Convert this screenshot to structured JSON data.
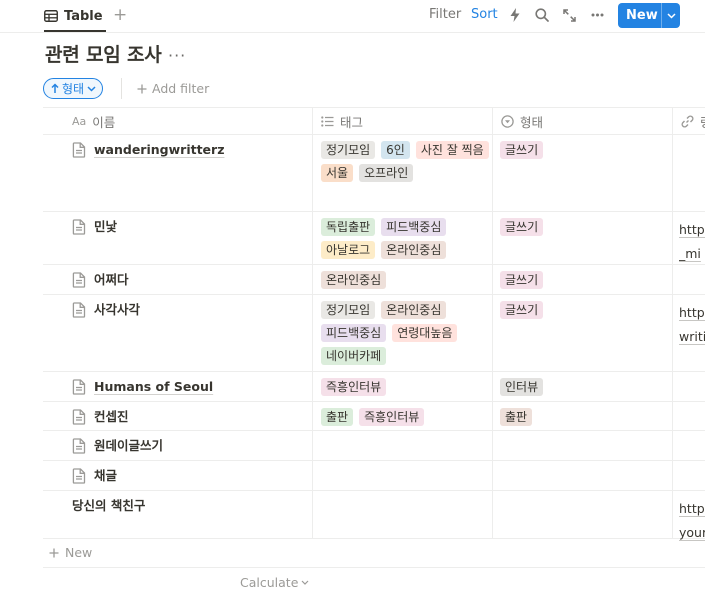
{
  "toolbar": {
    "view_tab": "Table",
    "view_icon": "table-icon",
    "add_view_symbol": "+",
    "filter_label": "Filter",
    "sort_label": "Sort",
    "new_label": "New",
    "accent_color": "#2383e2"
  },
  "page": {
    "title": "관련 모임 조사",
    "more_symbol": "···"
  },
  "filters": {
    "sort_chip_label": "형태",
    "add_filter_label": "Add filter"
  },
  "table": {
    "columns": [
      {
        "label": "이름",
        "icon_text": "Aa"
      },
      {
        "label": "태그",
        "icon": "list-icon"
      },
      {
        "label": "형태",
        "icon": "select-icon"
      },
      {
        "label": "링",
        "icon": "link-icon"
      }
    ],
    "rows": [
      {
        "name": "wanderingwritterz",
        "has_doc_icon": true,
        "underline": true,
        "tags": [
          {
            "label": "정기모임",
            "color": "#e9e8e5"
          },
          {
            "label": "6인",
            "color": "#d3e5ef"
          },
          {
            "label": "사진 잘 찍음",
            "color": "#ffe2dd"
          },
          {
            "label": "서울",
            "color": "#fadec9"
          },
          {
            "label": "오프라인",
            "color": "#e3e2e0"
          }
        ],
        "type": [
          {
            "label": "글쓰기",
            "color": "#f5e0e9"
          }
        ],
        "link": ""
      },
      {
        "name": "민낯",
        "has_doc_icon": true,
        "underline": false,
        "tags": [
          {
            "label": "독립출판",
            "color": "#dbeddb"
          },
          {
            "label": "피드백중심",
            "color": "#e8deee"
          },
          {
            "label": "아날로그",
            "color": "#fdecc8"
          },
          {
            "label": "온라인중심",
            "color": "#eee0da"
          }
        ],
        "type": [
          {
            "label": "글쓰기",
            "color": "#f5e0e9"
          }
        ],
        "link": "https://\n_mi"
      },
      {
        "name": "어쩌다",
        "has_doc_icon": true,
        "underline": false,
        "tags": [
          {
            "label": "온라인중심",
            "color": "#eee0da"
          }
        ],
        "type": [
          {
            "label": "글쓰기",
            "color": "#f5e0e9"
          }
        ],
        "link": ""
      },
      {
        "name": "사각사각",
        "has_doc_icon": true,
        "underline": false,
        "tags": [
          {
            "label": "정기모임",
            "color": "#e9e8e5"
          },
          {
            "label": "온라인중심",
            "color": "#eee0da"
          },
          {
            "label": "피드백중심",
            "color": "#e8deee"
          },
          {
            "label": "연령대높음",
            "color": "#ffe2dd"
          },
          {
            "label": "네이버카페",
            "color": "#dbeddb"
          }
        ],
        "type": [
          {
            "label": "글쓰기",
            "color": "#f5e0e9"
          }
        ],
        "link": "https://\nwriti"
      },
      {
        "name": "Humans of Seoul",
        "has_doc_icon": true,
        "underline": true,
        "tags": [
          {
            "label": "즉흥인터뷰",
            "color": "#f5e0e9"
          }
        ],
        "type": [
          {
            "label": "인터뷰",
            "color": "#e3e2e0"
          }
        ],
        "link": ""
      },
      {
        "name": "컨셉진",
        "has_doc_icon": true,
        "underline": false,
        "tags": [
          {
            "label": "출판",
            "color": "#dbeddb"
          },
          {
            "label": "즉흥인터뷰",
            "color": "#f5e0e9"
          }
        ],
        "type": [
          {
            "label": "출판",
            "color": "#eee0da"
          }
        ],
        "link": ""
      },
      {
        "name": "원데이글쓰기",
        "has_doc_icon": true,
        "underline": false,
        "tags": [],
        "type": [],
        "link": ""
      },
      {
        "name": "채글",
        "has_doc_icon": true,
        "underline": false,
        "tags": [],
        "type": [],
        "link": ""
      },
      {
        "name": "당신의 책친구",
        "has_doc_icon": false,
        "underline": false,
        "tags": [],
        "type": [],
        "link": "https://\nyour"
      }
    ],
    "new_row_label": "New",
    "calculate_label": "Calculate"
  }
}
